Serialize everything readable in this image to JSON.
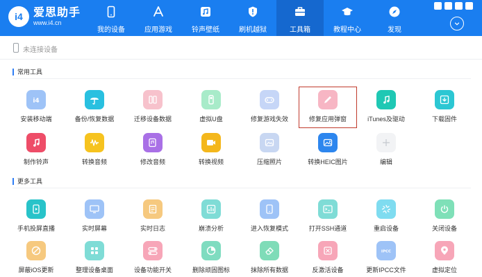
{
  "header": {
    "logo_mark": "i4",
    "brand_name": "爱思助手",
    "brand_url": "www.i4.cn",
    "nav": [
      {
        "label": "我的设备",
        "icon": "phone-icon"
      },
      {
        "label": "应用游戏",
        "icon": "app-store-icon"
      },
      {
        "label": "铃声壁纸",
        "icon": "music-icon"
      },
      {
        "label": "刷机越狱",
        "icon": "shield-icon"
      },
      {
        "label": "工具箱",
        "icon": "toolbox-icon",
        "active": true
      },
      {
        "label": "教程中心",
        "icon": "graduation-cap-icon"
      },
      {
        "label": "发现",
        "icon": "compass-icon"
      }
    ]
  },
  "device_bar": {
    "status": "未连接设备"
  },
  "common_tools": {
    "title": "常用工具",
    "items": [
      {
        "label": "安装移动端",
        "color": "#9ec3f7",
        "icon": "i4-icon"
      },
      {
        "label": "备份/恢复数据",
        "color": "#29c0e0",
        "icon": "umbrella-icon"
      },
      {
        "label": "迁移设备数据",
        "color": "#f7c2cc",
        "icon": "transfer-icon"
      },
      {
        "label": "虚拟U盘",
        "color": "#a8ebc9",
        "icon": "usb-icon"
      },
      {
        "label": "修复游戏失效",
        "color": "#c6d6f7",
        "icon": "gamepad-icon"
      },
      {
        "label": "修复应用弹窗",
        "color": "#f7b6c4",
        "icon": "pen-icon"
      },
      {
        "label": "iTunes及驱动",
        "color": "#1fc8b4",
        "icon": "music-note-icon"
      },
      {
        "label": "下载固件",
        "color": "#2cc7d3",
        "icon": "download-box-icon"
      },
      {
        "label": "制作铃声",
        "color": "#ee4d68",
        "icon": "bell-note-icon"
      },
      {
        "label": "转换音频",
        "color": "#f6c31f",
        "icon": "waveform-icon"
      },
      {
        "label": "修改音频",
        "color": "#a970e6",
        "icon": "audio-edit-icon"
      },
      {
        "label": "转换视频",
        "color": "#f4b71c",
        "icon": "video-icon"
      },
      {
        "label": "压缩照片",
        "color": "#c8d7f2",
        "icon": "photo-icon"
      },
      {
        "label": "转换HEIC图片",
        "color": "#2d86ee",
        "icon": "heic-icon"
      },
      {
        "label": "编辑",
        "color": "#f2f3f5",
        "icon": "plus-icon"
      }
    ]
  },
  "more_tools": {
    "title": "更多工具",
    "items": [
      {
        "label": "手机投屏直播",
        "color": "#28c3c9",
        "icon": "play-icon"
      },
      {
        "label": "实时屏幕",
        "color": "#9ec3f7",
        "icon": "screen-icon"
      },
      {
        "label": "实时日志",
        "color": "#f6c97f",
        "icon": "log-icon"
      },
      {
        "label": "崩溃分析",
        "color": "#7fdcd6",
        "icon": "analysis-icon"
      },
      {
        "label": "进入恢复模式",
        "color": "#9ec3f7",
        "icon": "recovery-icon"
      },
      {
        "label": "打开SSH通道",
        "color": "#7fdcd6",
        "icon": "terminal-icon"
      },
      {
        "label": "重启设备",
        "color": "#7fdcf0",
        "icon": "restart-icon"
      },
      {
        "label": "关闭设备",
        "color": "#7fe0b8",
        "icon": "power-icon"
      },
      {
        "label": "屏蔽iOS更新",
        "color": "#f6c97f",
        "icon": "block-update-icon"
      },
      {
        "label": "整理设备桌面",
        "color": "#7fdcd6",
        "icon": "grid-icon"
      },
      {
        "label": "设备功能开关",
        "color": "#f7a6b8",
        "icon": "toggle-icon"
      },
      {
        "label": "删除顽固图标",
        "color": "#7fdcc0",
        "icon": "pie-icon"
      },
      {
        "label": "抹除所有数据",
        "color": "#7fdcb8",
        "icon": "eraser-icon"
      },
      {
        "label": "反激活设备",
        "color": "#f7a6b8",
        "icon": "deactivate-icon"
      },
      {
        "label": "更新IPCC文件",
        "color": "#9ec3f7",
        "icon": "ipcc-icon"
      },
      {
        "label": "虚拟定位",
        "color": "#f7a6b8",
        "icon": "location-icon"
      }
    ]
  }
}
